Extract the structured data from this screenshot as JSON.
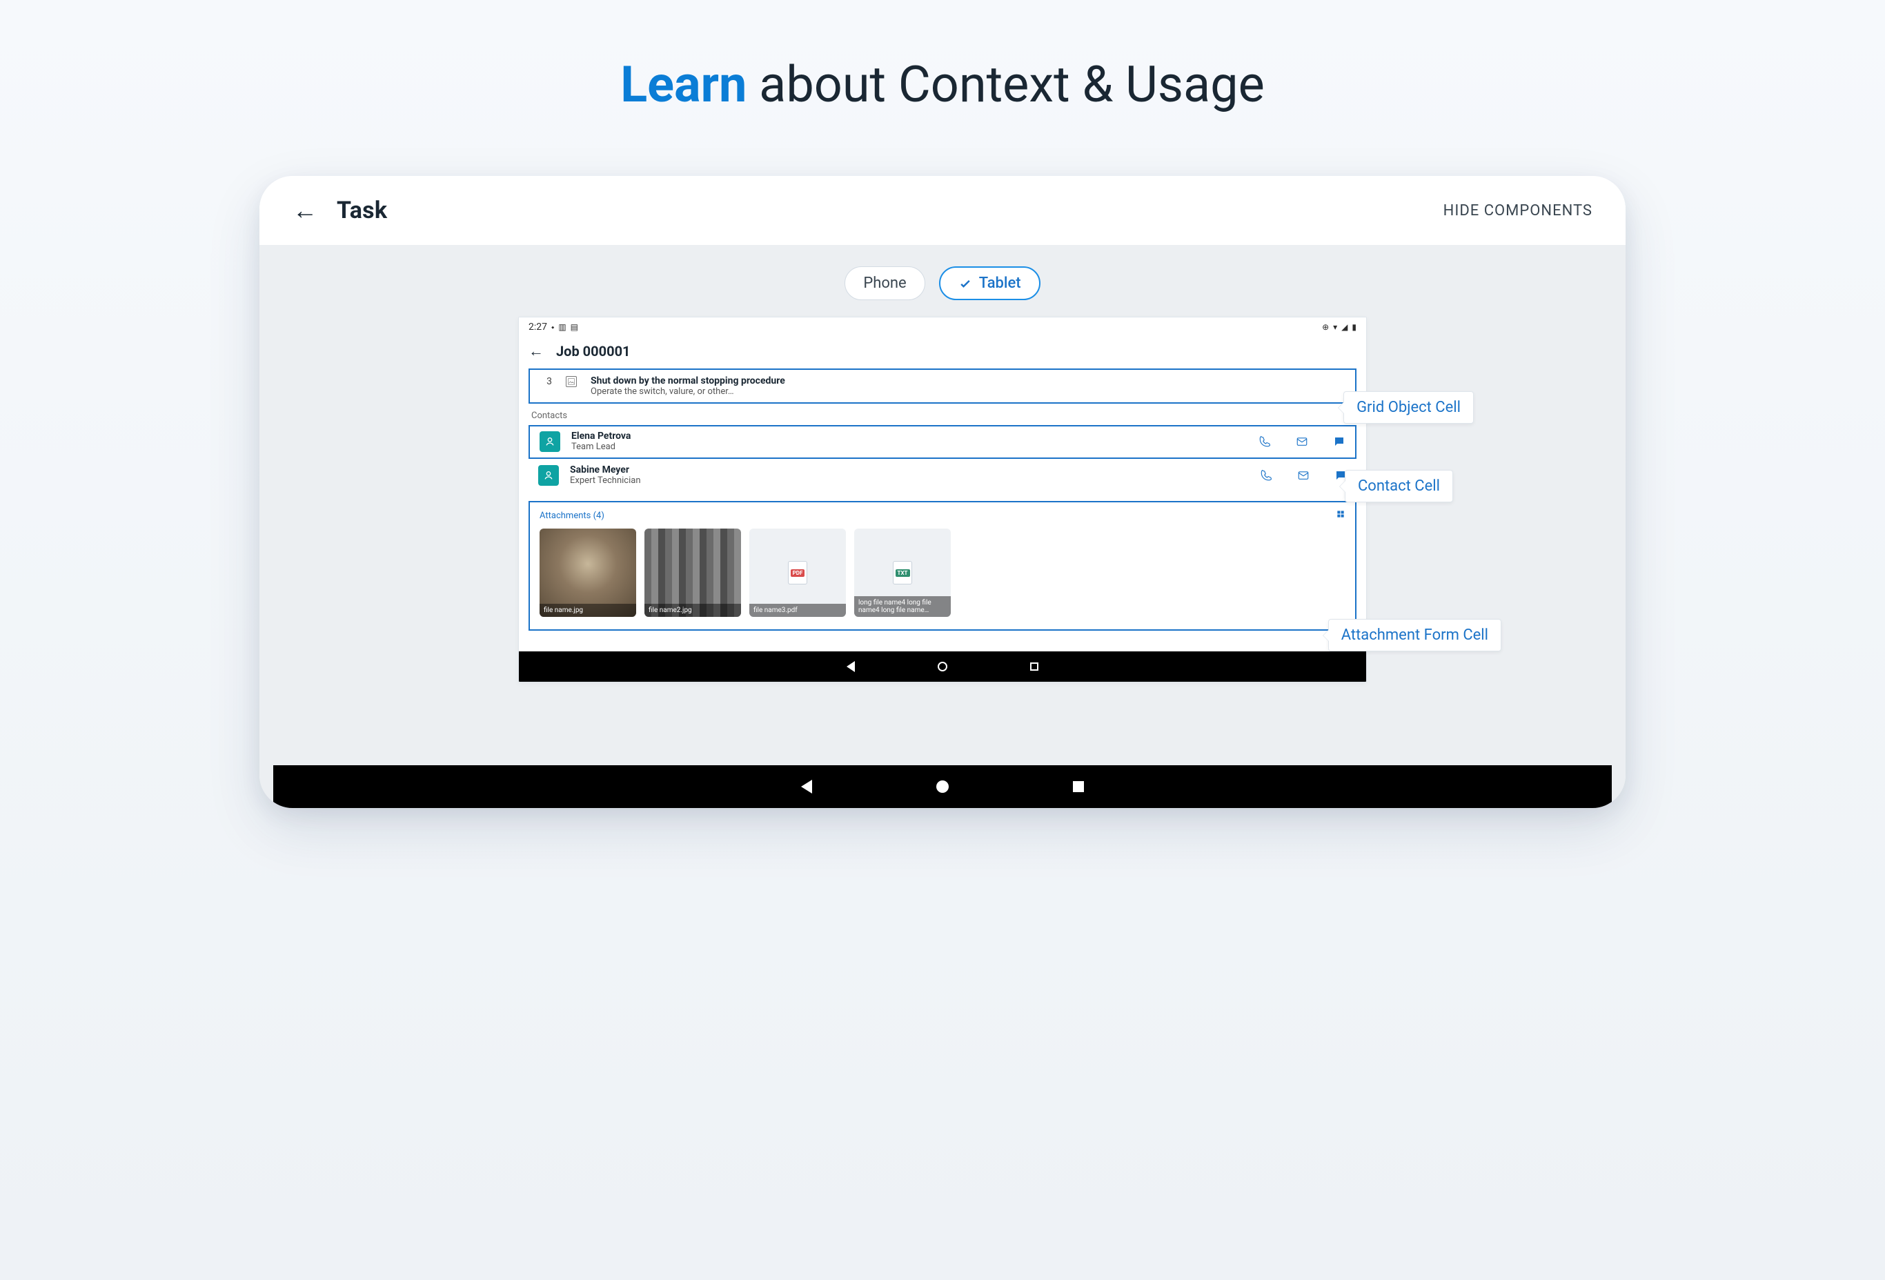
{
  "heading": {
    "accent": "Learn",
    "rest": " about Context & Usage"
  },
  "appbar": {
    "title": "Task",
    "hide_components": "HIDE COMPONENTS"
  },
  "segments": {
    "phone": "Phone",
    "tablet": "Tablet"
  },
  "inner": {
    "status_time": "2:27",
    "title": "Job 000001",
    "grid_cell": {
      "index": "3",
      "title": "Shut down by the normal stopping procedure",
      "subtitle": "Operate the switch, valure, or other…"
    },
    "contacts_label": "Contacts",
    "contacts": [
      {
        "name": "Elena Petrova",
        "role": "Team Lead"
      },
      {
        "name": "Sabine Meyer",
        "role": "Expert Technician"
      }
    ],
    "attachments_label": "Attachments (4)",
    "attachments": [
      {
        "caption": "file name.jpg"
      },
      {
        "caption": "file name2.jpg"
      },
      {
        "caption": "file name3.pdf",
        "badge": "PDF",
        "badge_color": "#d94b4b"
      },
      {
        "caption": "long file name4 long file name4 long file name…",
        "badge": "TXT",
        "badge_color": "#2f8f6f"
      }
    ]
  },
  "callouts": {
    "grid_cell": "Grid Object Cell",
    "contact_cell": "Contact Cell",
    "attachment_cell": "Attachment Form Cell"
  }
}
